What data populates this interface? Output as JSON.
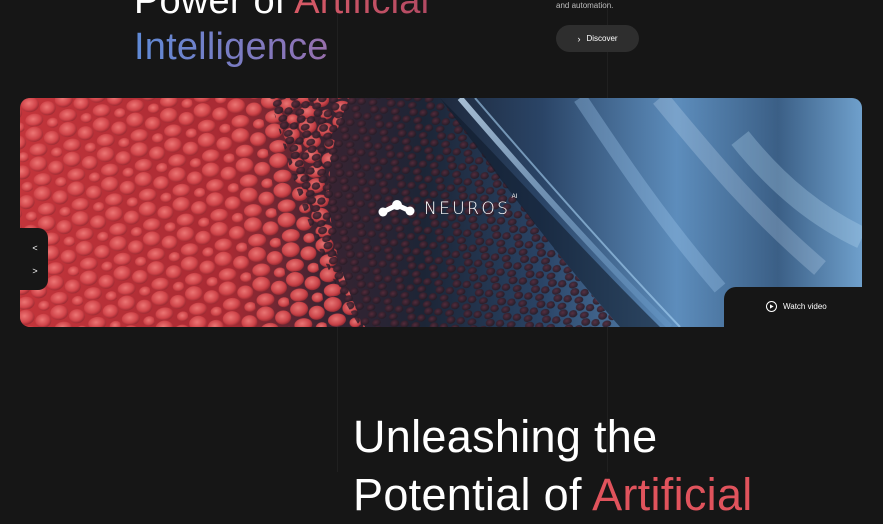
{
  "hero": {
    "title_line1_white": "Power of ",
    "title_line1_accent": "Artificial",
    "title_line2": "Intelligence",
    "description": "and automation.",
    "discover_label": "Discover"
  },
  "banner": {
    "brand": "NEUROS",
    "brand_superscript": "AI",
    "watch_video_label": "Watch video"
  },
  "slider_nav": {
    "prev_symbol": "<",
    "next_symbol": ">"
  },
  "section": {
    "title_line1": "Unleashing the",
    "title_line2_white": "Potential of ",
    "title_line2_accent": "Artificial"
  },
  "colors": {
    "background": "#161616",
    "accent_red": "#e0535c",
    "accent_blue": "#5f8ad6",
    "button_bg": "#2e2e2e"
  },
  "icons": {
    "discover": "chevron-right-icon",
    "watch": "play-icon",
    "prev": "chevron-left-icon",
    "next": "chevron-right-icon"
  }
}
